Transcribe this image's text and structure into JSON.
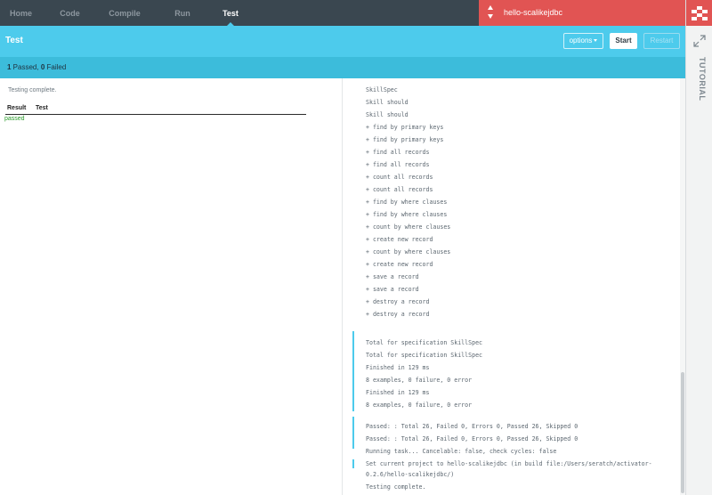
{
  "nav": {
    "items": [
      {
        "label": "Home",
        "active": false
      },
      {
        "label": "Code",
        "active": false
      },
      {
        "label": "Compile",
        "active": false
      },
      {
        "label": "Run",
        "active": false
      },
      {
        "label": "Test",
        "active": true
      }
    ],
    "project_name": "hello-scalikejdbc"
  },
  "sidebar": {
    "tutorial_label": "TUTORIAL"
  },
  "header": {
    "title": "Test",
    "options_label": "options",
    "start_label": "Start",
    "restart_label": "Restart"
  },
  "status": {
    "passed_count": "1",
    "passed_label": " Passed, ",
    "failed_count": "0",
    "failed_label": " Failed"
  },
  "results": {
    "message": "Testing complete.",
    "columns": [
      "Result",
      "Test"
    ],
    "rows": [
      {
        "result": "passed",
        "test": ""
      }
    ]
  },
  "console": {
    "lines": [
      "SkillSpec",
      "Skill should",
      "Skill should",
      "+ find by primary keys",
      "+ find by primary keys",
      "+ find all records",
      "+ find all records",
      "+ count all records",
      "+ count all records",
      "+ find by where clauses",
      "+ find by where clauses",
      "+ count by where clauses",
      "+ create new record",
      "+ count by where clauses",
      "+ create new record",
      "+ save a record",
      "+ save a record",
      "+ destroy a record",
      "+ destroy a record",
      "Total for specification SkillSpec",
      "Total for specification SkillSpec",
      "Finished in 129 ms",
      "8 examples, 0 failure, 0 error",
      "Finished in 129 ms",
      "8 examples, 0 failure, 0 error",
      "Passed: : Total 26, Failed 0, Errors 0, Passed 26, Skipped 0",
      "Passed: : Total 26, Failed 0, Errors 0, Passed 26, Skipped 0",
      "Running task... Cancelable: false, check cycles: false",
      "Set current project to hello-scalikejdbc (in build file:/Users/seratch/activator-",
      "0.2.6/hello-scalikejdbc/)",
      "Testing complete."
    ]
  },
  "colors": {
    "nav_bg": "#3a4750",
    "accent": "#4dcbec",
    "status_bg": "#3cbcdb",
    "project_bg": "#e15453",
    "pass_green": "#2a9a2a"
  }
}
